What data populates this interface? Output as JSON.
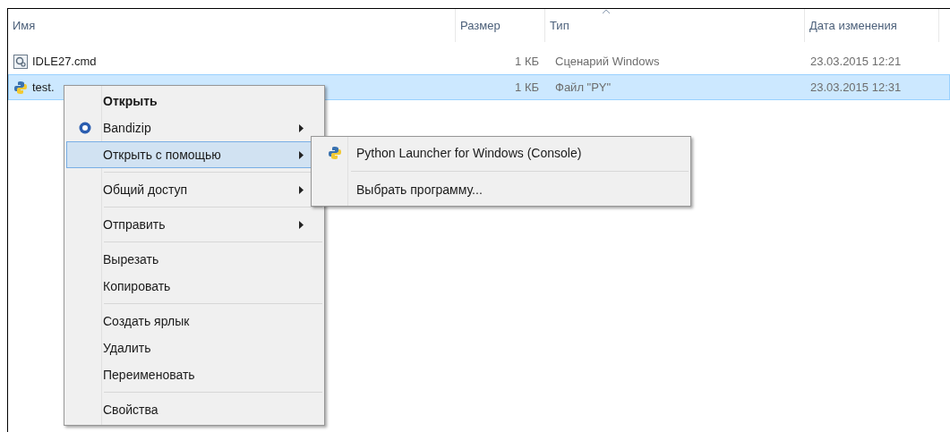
{
  "table": {
    "columns": [
      {
        "label": "Имя",
        "sorted": false
      },
      {
        "label": "Размер",
        "sorted": false
      },
      {
        "label": "Тип",
        "sorted": true
      },
      {
        "label": "Дата изменения",
        "sorted": false
      }
    ],
    "rows": [
      {
        "kind": "script",
        "name": "IDLE27.cmd",
        "size": "1 КБ",
        "type": "Сценарий Windows",
        "date": "23.03.2015 12:21",
        "selected": false
      },
      {
        "kind": "python",
        "name": "test.",
        "size": "1 КБ",
        "type": "Файл \"PY\"",
        "date": "23.03.2015 12:31",
        "selected": true
      }
    ]
  },
  "context_menu": {
    "items": [
      {
        "kind": "item",
        "label": "Открыть",
        "bold": true,
        "submenu": false,
        "selected": false,
        "icon": false
      },
      {
        "kind": "item",
        "label": "Bandizip",
        "bold": false,
        "submenu": true,
        "selected": false,
        "icon": true
      },
      {
        "kind": "item",
        "label": "Открыть с помощью",
        "bold": false,
        "submenu": true,
        "selected": true,
        "icon": false
      },
      {
        "kind": "separator"
      },
      {
        "kind": "item",
        "label": "Общий доступ",
        "bold": false,
        "submenu": true,
        "selected": false,
        "icon": false
      },
      {
        "kind": "separator"
      },
      {
        "kind": "item",
        "label": "Отправить",
        "bold": false,
        "submenu": true,
        "selected": false,
        "icon": false
      },
      {
        "kind": "separator"
      },
      {
        "kind": "item",
        "label": "Вырезать",
        "bold": false,
        "submenu": false,
        "selected": false,
        "icon": false
      },
      {
        "kind": "item",
        "label": "Копировать",
        "bold": false,
        "submenu": false,
        "selected": false,
        "icon": false
      },
      {
        "kind": "separator"
      },
      {
        "kind": "item",
        "label": "Создать ярлык",
        "bold": false,
        "submenu": false,
        "selected": false,
        "icon": false
      },
      {
        "kind": "item",
        "label": "Удалить",
        "bold": false,
        "submenu": false,
        "selected": false,
        "icon": false
      },
      {
        "kind": "item",
        "label": "Переименовать",
        "bold": false,
        "submenu": false,
        "selected": false,
        "icon": false
      },
      {
        "kind": "separator"
      },
      {
        "kind": "item",
        "label": "Свойства",
        "bold": false,
        "submenu": false,
        "selected": false,
        "icon": false
      }
    ]
  },
  "submenu": {
    "items": [
      {
        "kind": "item",
        "label": "Python Launcher for Windows (Console)",
        "icon": true
      },
      {
        "kind": "separator"
      },
      {
        "kind": "item",
        "label": "Выбрать программу...",
        "icon": false
      }
    ]
  }
}
